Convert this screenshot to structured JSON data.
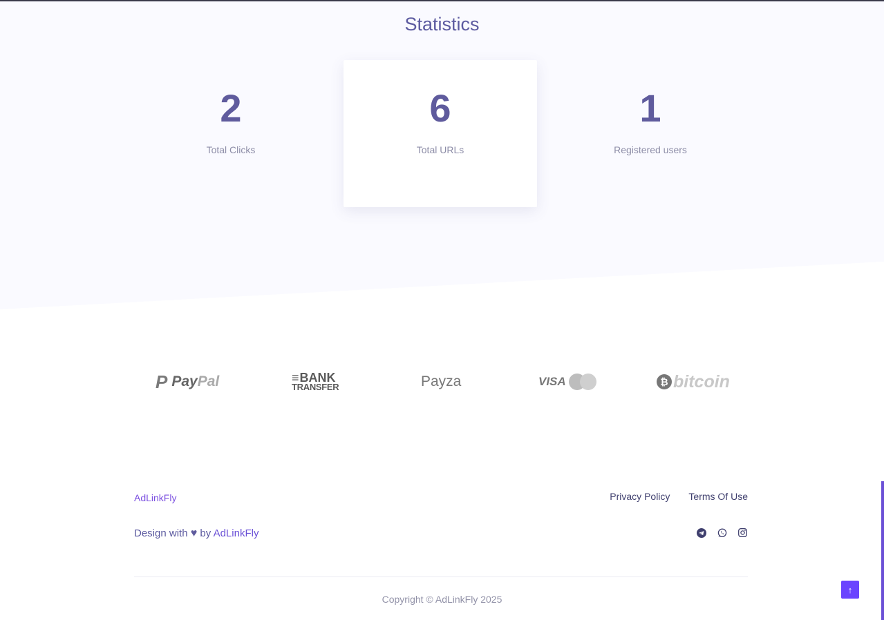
{
  "stats": {
    "title": "Statistics",
    "items": [
      {
        "value": "2",
        "label": "Total Clicks"
      },
      {
        "value": "6",
        "label": "Total URLs"
      },
      {
        "value": "1",
        "label": "Registered users"
      }
    ]
  },
  "payments": {
    "paypal": {
      "pay": "Pay",
      "pal": "Pal"
    },
    "bank": {
      "line1": "BANK",
      "line2": "TRANSFER"
    },
    "payza": "Payza",
    "visa": "VISA",
    "bitcoin": "bitcoin"
  },
  "footer": {
    "brand": "AdLinkFly",
    "links": {
      "privacy": "Privacy Policy",
      "terms": "Terms Of Use"
    },
    "design_prefix": "Design with",
    "design_by": "by",
    "design_brand": "AdLinkFly",
    "social_icons": [
      "telegram-icon",
      "whatsapp-icon",
      "instagram-icon"
    ],
    "copyright": "Copyright © AdLinkFly 2025"
  },
  "colors": {
    "accent": "#6b44ff",
    "brand_text": "#5c5aa0"
  }
}
